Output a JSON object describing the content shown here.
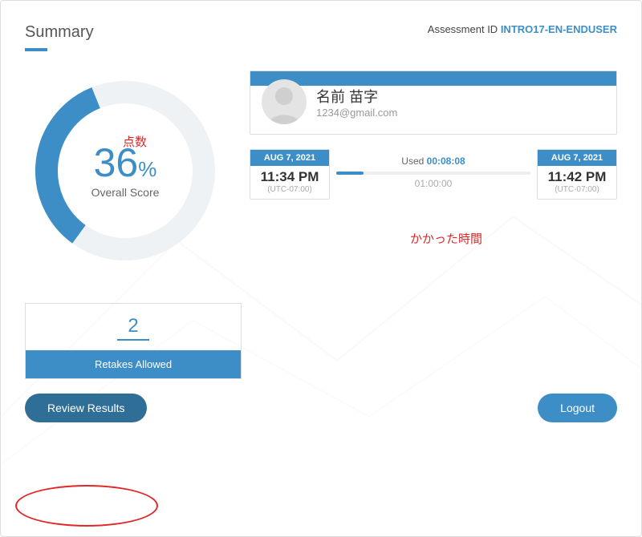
{
  "header": {
    "title": "Summary",
    "assessment_id_label": "Assessment ID ",
    "assessment_id": "INTRO17-EN-ENDUSER"
  },
  "score": {
    "value": "36",
    "pct_sign": "%",
    "label": "Overall Score",
    "arc_percent": 36
  },
  "user": {
    "name": "名前 苗字",
    "email": "1234@gmail.com"
  },
  "time": {
    "start": {
      "date": "AUG 7, 2021",
      "time": "11:34 PM",
      "tz": "(UTC-07:00)"
    },
    "end": {
      "date": "AUG 7, 2021",
      "time": "11:42 PM",
      "tz": "(UTC-07:00)"
    },
    "used_label": "Used ",
    "used_value": "00:08:08",
    "max": "01:00:00"
  },
  "retakes": {
    "value": "2",
    "label": "Retakes Allowed"
  },
  "buttons": {
    "review": "Review Results",
    "logout": "Logout"
  },
  "annotations": {
    "score": "点数",
    "time": "かかった時間"
  },
  "colors": {
    "accent": "#3d8ec7"
  }
}
